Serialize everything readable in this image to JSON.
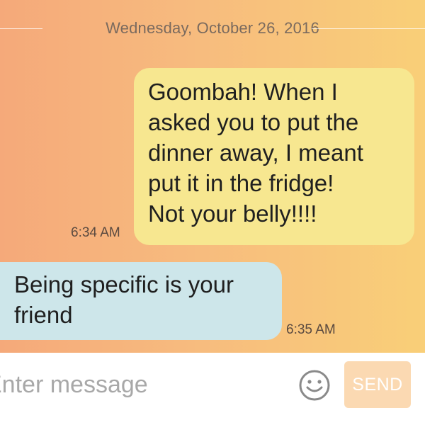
{
  "conversation": {
    "date_divider": "Wednesday, October 26, 2016",
    "messages": [
      {
        "direction": "sent",
        "lines": [
          "Goombah! When I",
          "asked you to put the",
          "dinner away, I meant",
          "put it in the fridge!",
          "Not your belly!!!!"
        ],
        "time": "6:34 AM"
      },
      {
        "direction": "received",
        "lines": [
          "Being specific is your",
          "friend"
        ],
        "time": "6:35 AM"
      }
    ]
  },
  "composer": {
    "placeholder": "Enter message",
    "emoji_icon": "smiley-face-icon",
    "send_label": "SEND"
  },
  "colors": {
    "background_gradient_start": "#f5a97a",
    "background_gradient_end": "#f9cf78",
    "sent_bubble": "#f7e790",
    "received_bubble": "#cde6ea",
    "send_button": "#fbd9b2"
  }
}
